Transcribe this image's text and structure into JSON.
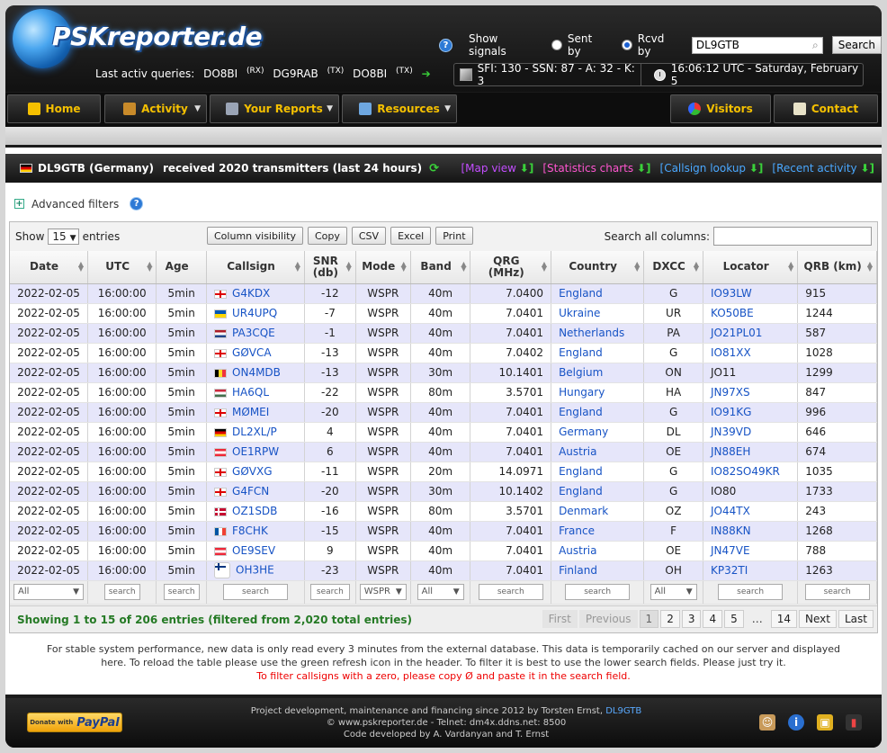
{
  "header": {
    "logo_text": "PSKreporter.de",
    "last_queries_label": "Last activ queries:",
    "last_queries": [
      {
        "call": "DO8BI",
        "tag": "(RX)"
      },
      {
        "call": "DG9RAB",
        "tag": "(TX)"
      },
      {
        "call": "DO8BI",
        "tag": "(TX)"
      }
    ],
    "arrow": "➔",
    "help": "?",
    "show_signals_label": "Show signals",
    "sent_by_label": "Sent by",
    "rcvd_by_label": "Rcvd by",
    "search_value": "DL9GTB",
    "search_button": "Search",
    "sfi_text": "SFI: 130 - SSN: 87 - A: 32 - K: 3",
    "time_text": "16:06:12 UTC - Saturday, February 5"
  },
  "nav": {
    "home": "Home",
    "activity": "Activity",
    "your_reports": "Your Reports",
    "resources": "Resources",
    "visitors": "Visitors",
    "contact": "Contact"
  },
  "title": {
    "callsign": "DL9GTB (Germany)",
    "text": "received 2020 transmitters (last 24 hours)",
    "links": [
      "[Map view",
      "[Statistics charts",
      "[Callsign lookup",
      "[Recent activity"
    ],
    "link_arrow": "⬇]"
  },
  "advanced_filters": "Advanced filters",
  "controls": {
    "show": "Show",
    "entries_value": "15",
    "entries": "entries",
    "buttons": [
      "Column visibility",
      "Copy",
      "CSV",
      "Excel",
      "Print"
    ],
    "search_all": "Search all columns:"
  },
  "columns": [
    "Date",
    "UTC",
    "Age",
    "Callsign",
    "SNR (db)",
    "Mode",
    "Band",
    "QRG (MHz)",
    "Country",
    "DXCC",
    "Locator",
    "QRB (km)"
  ],
  "rows": [
    {
      "date": "2022-02-05",
      "utc": "16:00:00",
      "age": "5min",
      "flag": "en",
      "call": "G4KDX",
      "snr": "-12",
      "mode": "WSPR",
      "band": "40m",
      "qrg": "7.0400",
      "country": "England",
      "dxcc": "G",
      "loc": "IO93LW",
      "loc_link": true,
      "qrb": "915"
    },
    {
      "date": "2022-02-05",
      "utc": "16:00:00",
      "age": "5min",
      "flag": "ua",
      "call": "UR4UPQ",
      "snr": "-7",
      "mode": "WSPR",
      "band": "40m",
      "qrg": "7.0401",
      "country": "Ukraine",
      "dxcc": "UR",
      "loc": "KO50BE",
      "loc_link": true,
      "qrb": "1244"
    },
    {
      "date": "2022-02-05",
      "utc": "16:00:00",
      "age": "5min",
      "flag": "nl",
      "call": "PA3CQE",
      "snr": "-1",
      "mode": "WSPR",
      "band": "40m",
      "qrg": "7.0401",
      "country": "Netherlands",
      "dxcc": "PA",
      "loc": "JO21PL01",
      "loc_link": true,
      "qrb": "587"
    },
    {
      "date": "2022-02-05",
      "utc": "16:00:00",
      "age": "5min",
      "flag": "en",
      "call": "GØVCA",
      "snr": "-13",
      "mode": "WSPR",
      "band": "40m",
      "qrg": "7.0402",
      "country": "England",
      "dxcc": "G",
      "loc": "IO81XX",
      "loc_link": true,
      "qrb": "1028"
    },
    {
      "date": "2022-02-05",
      "utc": "16:00:00",
      "age": "5min",
      "flag": "be",
      "call": "ON4MDB",
      "snr": "-13",
      "mode": "WSPR",
      "band": "30m",
      "qrg": "10.1401",
      "country": "Belgium",
      "dxcc": "ON",
      "loc": "JO11",
      "loc_link": false,
      "qrb": "1299"
    },
    {
      "date": "2022-02-05",
      "utc": "16:00:00",
      "age": "5min",
      "flag": "hu",
      "call": "HA6QL",
      "snr": "-22",
      "mode": "WSPR",
      "band": "80m",
      "qrg": "3.5701",
      "country": "Hungary",
      "dxcc": "HA",
      "loc": "JN97XS",
      "loc_link": true,
      "qrb": "847"
    },
    {
      "date": "2022-02-05",
      "utc": "16:00:00",
      "age": "5min",
      "flag": "en",
      "call": "MØMEI",
      "snr": "-20",
      "mode": "WSPR",
      "band": "40m",
      "qrg": "7.0401",
      "country": "England",
      "dxcc": "G",
      "loc": "IO91KG",
      "loc_link": true,
      "qrb": "996"
    },
    {
      "date": "2022-02-05",
      "utc": "16:00:00",
      "age": "5min",
      "flag": "de",
      "call": "DL2XL/P",
      "snr": "4",
      "mode": "WSPR",
      "band": "40m",
      "qrg": "7.0401",
      "country": "Germany",
      "dxcc": "DL",
      "loc": "JN39VD",
      "loc_link": true,
      "qrb": "646"
    },
    {
      "date": "2022-02-05",
      "utc": "16:00:00",
      "age": "5min",
      "flag": "at",
      "call": "OE1RPW",
      "snr": "6",
      "mode": "WSPR",
      "band": "40m",
      "qrg": "7.0401",
      "country": "Austria",
      "dxcc": "OE",
      "loc": "JN88EH",
      "loc_link": true,
      "qrb": "674"
    },
    {
      "date": "2022-02-05",
      "utc": "16:00:00",
      "age": "5min",
      "flag": "en",
      "call": "GØVXG",
      "snr": "-11",
      "mode": "WSPR",
      "band": "20m",
      "qrg": "14.0971",
      "country": "England",
      "dxcc": "G",
      "loc": "IO82SO49KR",
      "loc_link": true,
      "qrb": "1035"
    },
    {
      "date": "2022-02-05",
      "utc": "16:00:00",
      "age": "5min",
      "flag": "en",
      "call": "G4FCN",
      "snr": "-20",
      "mode": "WSPR",
      "band": "30m",
      "qrg": "10.1402",
      "country": "England",
      "dxcc": "G",
      "loc": "IO80",
      "loc_link": false,
      "qrb": "1733"
    },
    {
      "date": "2022-02-05",
      "utc": "16:00:00",
      "age": "5min",
      "flag": "dk",
      "call": "OZ1SDB",
      "snr": "-16",
      "mode": "WSPR",
      "band": "80m",
      "qrg": "3.5701",
      "country": "Denmark",
      "dxcc": "OZ",
      "loc": "JO44TX",
      "loc_link": true,
      "qrb": "243"
    },
    {
      "date": "2022-02-05",
      "utc": "16:00:00",
      "age": "5min",
      "flag": "fr",
      "call": "F8CHK",
      "snr": "-15",
      "mode": "WSPR",
      "band": "40m",
      "qrg": "7.0401",
      "country": "France",
      "dxcc": "F",
      "loc": "IN88KN",
      "loc_link": true,
      "qrb": "1268"
    },
    {
      "date": "2022-02-05",
      "utc": "16:00:00",
      "age": "5min",
      "flag": "at",
      "call": "OE9SEV",
      "snr": "9",
      "mode": "WSPR",
      "band": "40m",
      "qrg": "7.0401",
      "country": "Austria",
      "dxcc": "OE",
      "loc": "JN47VE",
      "loc_link": true,
      "qrb": "788"
    },
    {
      "date": "2022-02-05",
      "utc": "16:00:00",
      "age": "5min",
      "flag": "fi",
      "call": "OH3HE",
      "snr": "-23",
      "mode": "WSPR",
      "band": "40m",
      "qrg": "7.0401",
      "country": "Finland",
      "dxcc": "OH",
      "loc": "KP32TI",
      "loc_link": true,
      "qrb": "1263"
    }
  ],
  "filters": {
    "all": "All",
    "search": "search",
    "wspr": "WSPR"
  },
  "showing": "Showing 1 to 15 of 206 entries (filtered from 2,020 total entries)",
  "pager": {
    "first": "First",
    "previous": "Previous",
    "pages": [
      "1",
      "2",
      "3",
      "4",
      "5"
    ],
    "ellipsis": "…",
    "last_page": "14",
    "next": "Next",
    "last": "Last"
  },
  "notes": {
    "line1": "For stable system performance, new data is only read every 3 minutes from the external database. This data is temporarily cached on our server and displayed",
    "line2": "here. To reload the table please use the green refresh icon in the header. To filter it is best to use the lower search fields. Please just try it.",
    "line3": "To filter callsigns with a zero, please copy Ø and paste it in the search field."
  },
  "footer": {
    "donate": "Donate with",
    "paypal": "PayPal",
    "line1": "Project development, maintenance and financing since 2012 by Torsten Ernst,",
    "line1_call": "DL9GTB",
    "line2": "© www.pskreporter.de - Telnet: dm4x.ddns.net: 8500",
    "line3": "Code developed by A. Vardanyan and T. Ernst"
  }
}
